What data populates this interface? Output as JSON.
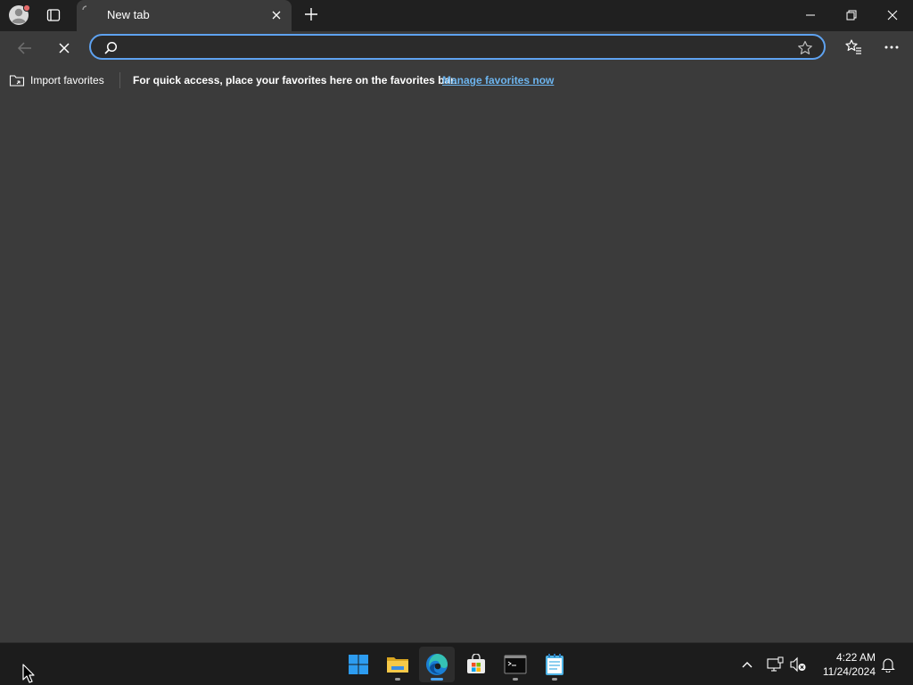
{
  "tab": {
    "title": "New tab"
  },
  "address_bar": {
    "value": "",
    "placeholder": ""
  },
  "favorites_bar": {
    "import_label": "Import favorites",
    "message": "For quick access, place your favorites here on the favorites bar.",
    "link_label": "Manage favorites now"
  },
  "taskbar": {
    "apps": [
      "start-icon",
      "file-explorer-icon",
      "edge-icon",
      "store-icon",
      "terminal-icon",
      "notepad-icon"
    ],
    "active_app": "edge-icon"
  },
  "clock": {
    "time": "4:22 AM",
    "date": "11/24/2024"
  },
  "colors": {
    "accent": "#5ea2f0",
    "link": "#6cb4ee",
    "titlebar": "#202020",
    "content": "#3b3b3b",
    "taskbar": "#1c1c1c"
  }
}
